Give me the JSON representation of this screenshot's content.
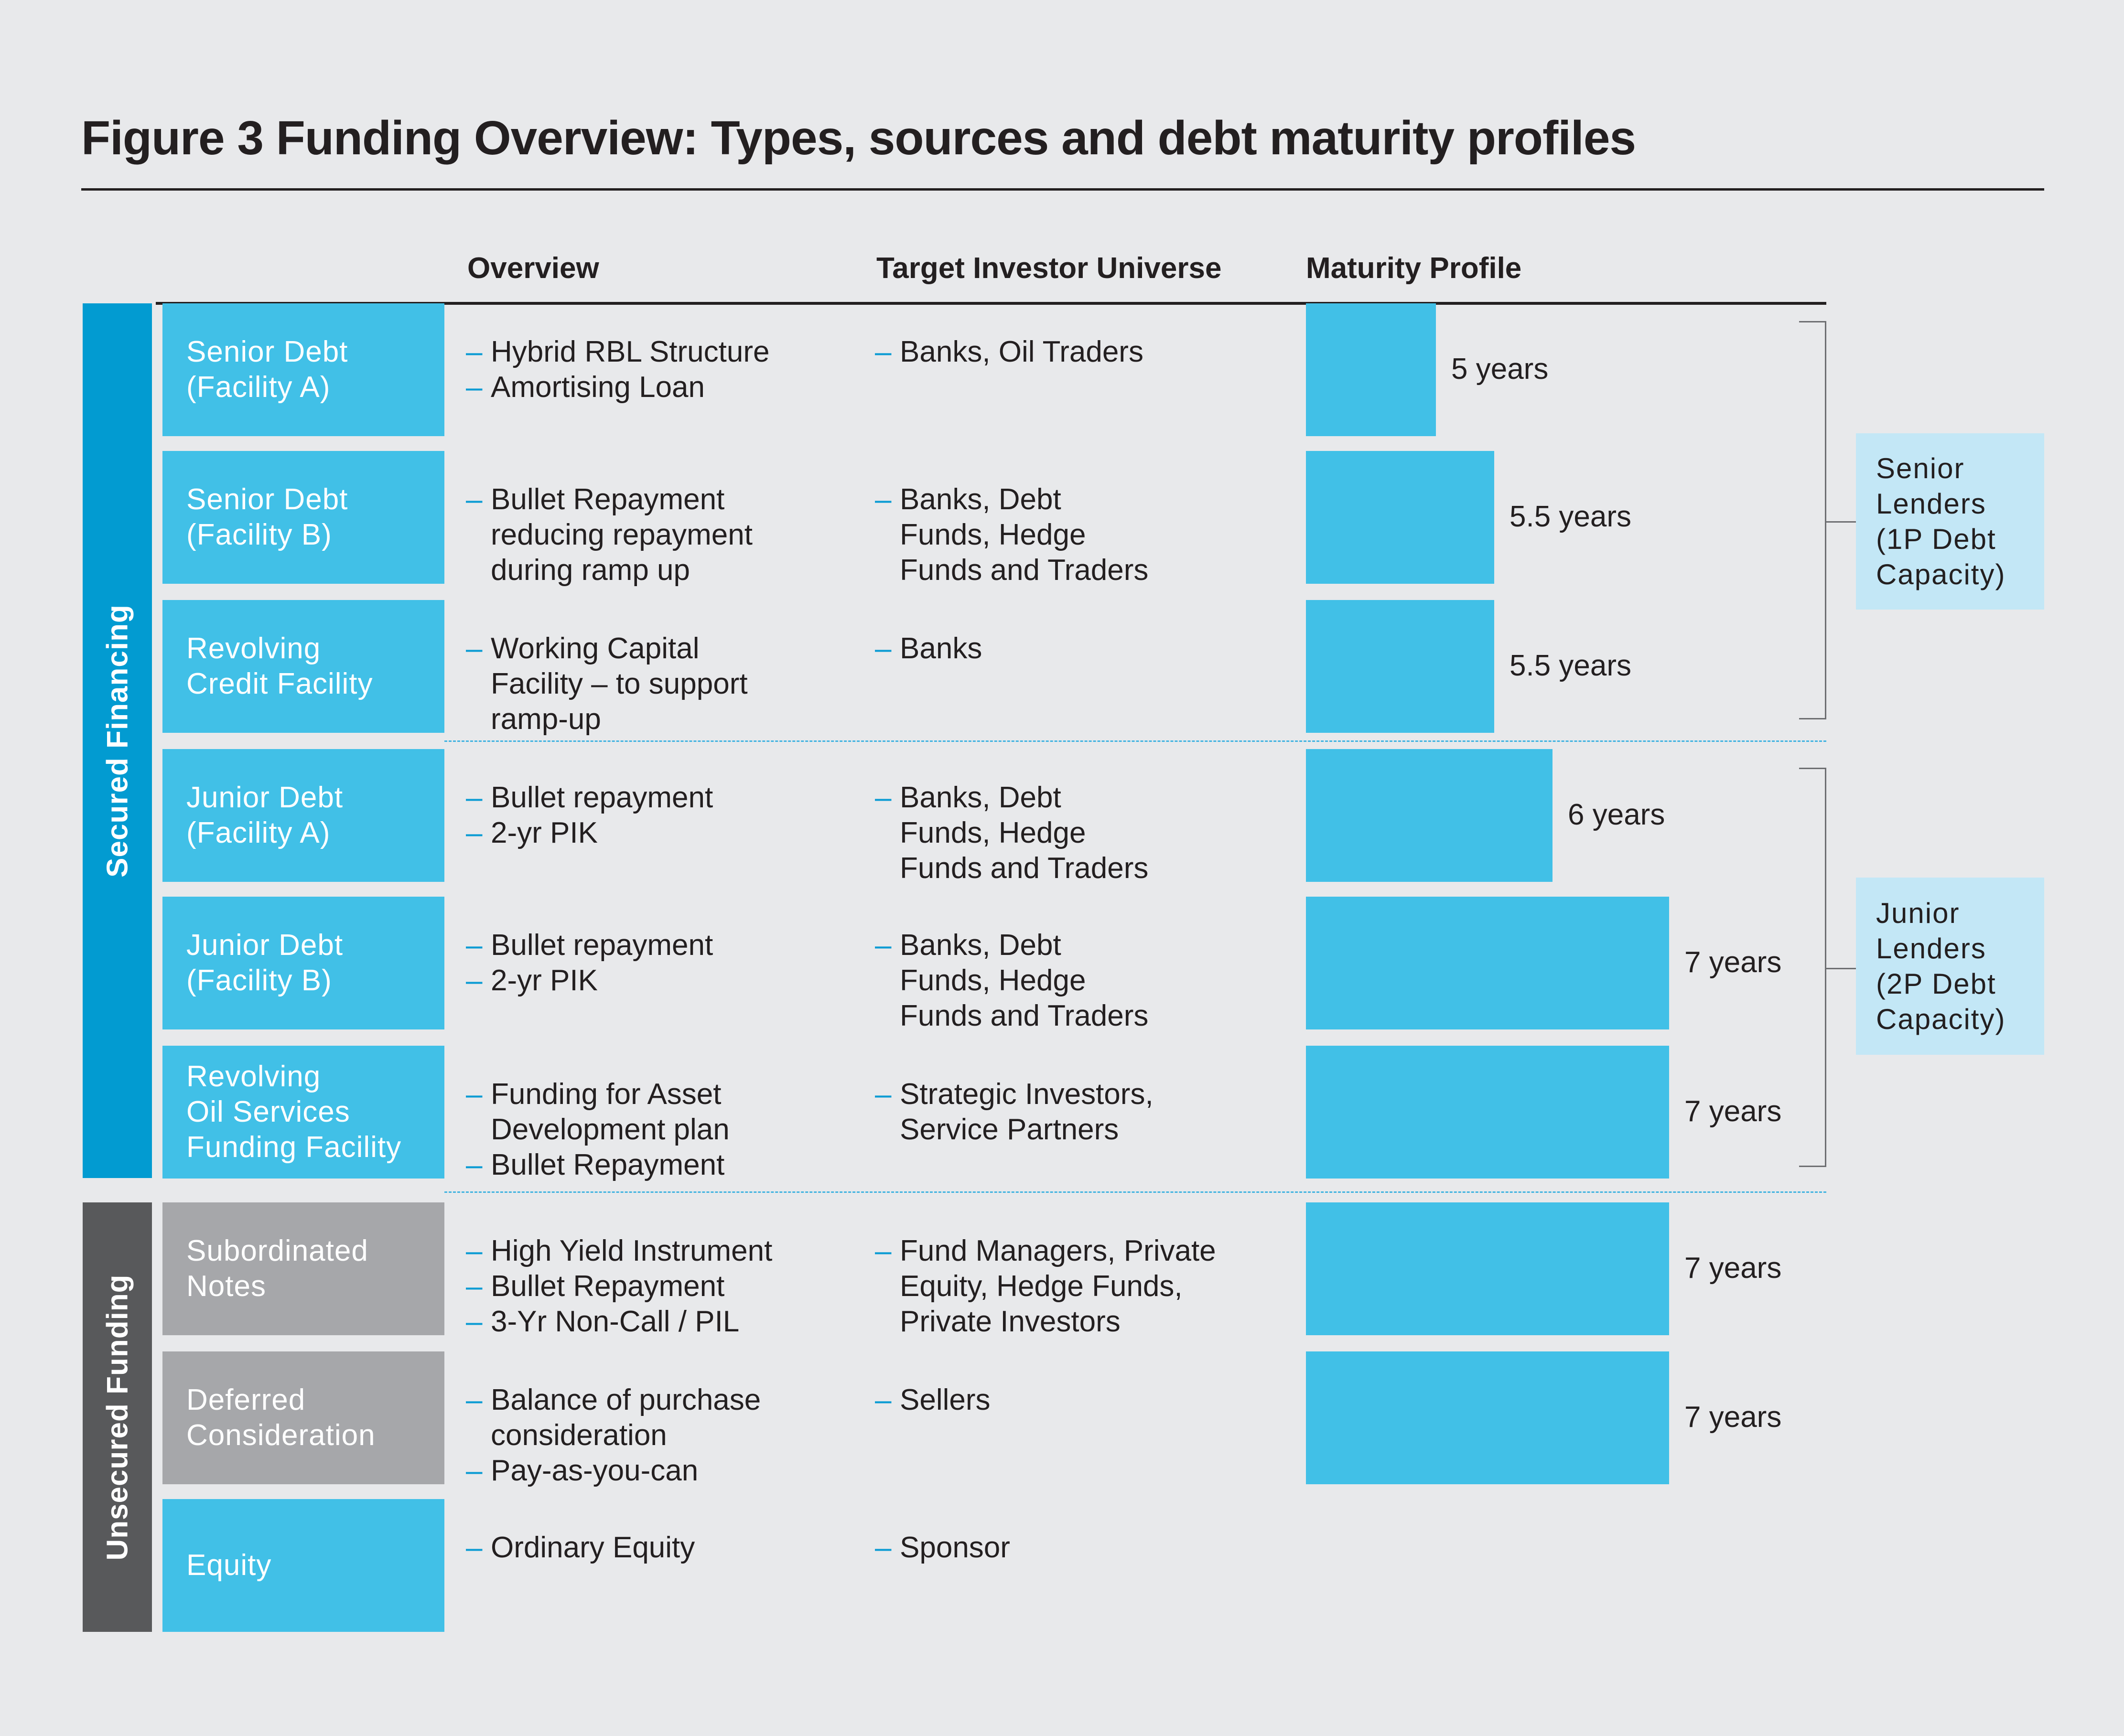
{
  "title": "Figure 3 Funding Overview: Types, sources and debt maturity profiles",
  "columns": {
    "overview": "Overview",
    "investors": "Target Investor Universe",
    "maturity": "Maturity Profile"
  },
  "sections": [
    {
      "label": "Secured Financing",
      "color": "#029bd1"
    },
    {
      "label": "Unsecured Funding",
      "color": "#58595b"
    }
  ],
  "lenders": [
    {
      "label": "Senior\nLenders\n(1P Debt\nCapacity)"
    },
    {
      "label": "Junior\nLenders\n(2P Debt\nCapacity)"
    }
  ],
  "rows": [
    {
      "name": "Senior Debt\n(Facility A)",
      "box_color": "#41c0e7",
      "overview": [
        "Hybrid RBL Structure",
        "Amortising Loan"
      ],
      "investors": [
        "Banks, Oil Traders"
      ],
      "maturity_years": 5,
      "maturity_label": "5 years"
    },
    {
      "name": "Senior Debt\n(Facility B)",
      "box_color": "#41c0e7",
      "overview": [
        "Bullet Repayment\nreducing repayment\nduring ramp up"
      ],
      "investors": [
        "Banks, Debt\nFunds, Hedge\nFunds and Traders"
      ],
      "maturity_years": 5.5,
      "maturity_label": "5.5 years"
    },
    {
      "name": "Revolving\nCredit Facility",
      "box_color": "#41c0e7",
      "overview": [
        "Working Capital\nFacility – to support\nramp-up"
      ],
      "investors": [
        "Banks"
      ],
      "maturity_years": 5.5,
      "maturity_label": "5.5 years"
    },
    {
      "name": "Junior Debt\n(Facility A)",
      "box_color": "#41c0e7",
      "overview": [
        "Bullet repayment",
        "2-yr PIK"
      ],
      "investors": [
        "Banks, Debt\nFunds, Hedge\nFunds and Traders"
      ],
      "maturity_years": 6,
      "maturity_label": "6 years"
    },
    {
      "name": "Junior Debt\n(Facility B)",
      "box_color": "#41c0e7",
      "overview": [
        "Bullet repayment",
        "2-yr PIK"
      ],
      "investors": [
        "Banks, Debt\nFunds, Hedge\nFunds and Traders"
      ],
      "maturity_years": 7,
      "maturity_label": "7 years"
    },
    {
      "name": "Revolving\nOil Services\nFunding Facility",
      "box_color": "#41c0e7",
      "overview": [
        "Funding for Asset\nDevelopment plan",
        "Bullet Repayment"
      ],
      "investors": [
        "Strategic Investors,\nService Partners"
      ],
      "maturity_years": 7,
      "maturity_label": "7 years"
    },
    {
      "name": "Subordinated\nNotes",
      "box_color": "#a6a7aa",
      "overview": [
        "High Yield Instrument",
        "Bullet Repayment",
        "3-Yr Non-Call / PIL"
      ],
      "investors": [
        "Fund Managers, Private\nEquity, Hedge Funds,\nPrivate Investors"
      ],
      "maturity_years": 7,
      "maturity_label": "7 years"
    },
    {
      "name": "Deferred\nConsideration",
      "box_color": "#a6a7aa",
      "overview": [
        "Balance of purchase\nconsideration",
        "Pay-as-you-can"
      ],
      "investors": [
        "Sellers"
      ],
      "maturity_years": 7,
      "maturity_label": "7 years"
    },
    {
      "name": "Equity",
      "box_color": "#41c0e7",
      "overview": [
        "Ordinary Equity"
      ],
      "investors": [
        "Sponsor"
      ],
      "maturity_years": null,
      "maturity_label": null
    }
  ],
  "bullet_glyph": "–"
}
